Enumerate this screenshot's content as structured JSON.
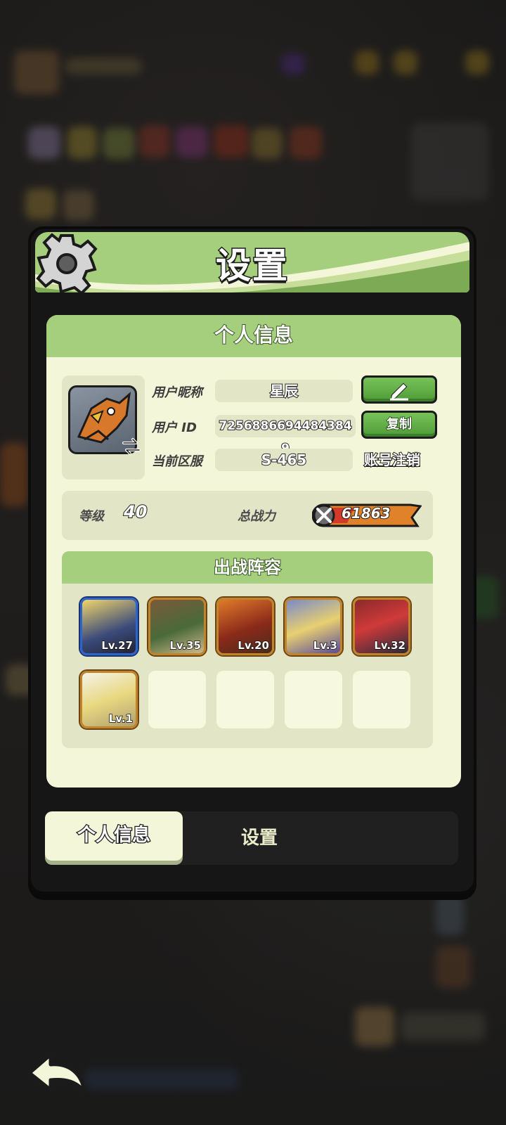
{
  "modal": {
    "title": "设置"
  },
  "profile": {
    "section_title": "个人信息",
    "nickname_label": "用户昵称",
    "nickname": "星辰",
    "id_label": "用户 ID",
    "user_id": "7256886694484384​9",
    "server_label": "当前区服",
    "server": "S-465",
    "copy_label": "复制",
    "cancel_account_label": "账号注销"
  },
  "stats": {
    "level_label": "等级",
    "level": "40",
    "power_label": "总战力",
    "power": "61863"
  },
  "lineup": {
    "title": "出战阵容",
    "heroes": [
      {
        "level": "Lv.27",
        "frame": "blue"
      },
      {
        "level": "Lv.35",
        "frame": "gold"
      },
      {
        "level": "Lv.20",
        "frame": "gold"
      },
      {
        "level": "Lv.3",
        "frame": "gold"
      },
      {
        "level": "Lv.32",
        "frame": "gold"
      },
      {
        "level": "Lv.1",
        "frame": "gold"
      }
    ],
    "empty_slots": 4
  },
  "tabs": [
    {
      "label": "个人信息",
      "active": true
    },
    {
      "label": "设置",
      "active": false
    }
  ],
  "icons": [
    "gear-icon",
    "swap-icon",
    "edit-icon",
    "power-icon",
    "back-icon"
  ],
  "colors": {
    "accent_green": "#a6cf7d",
    "panel": "#f4f6d9",
    "button_green": "#5aa83e"
  }
}
